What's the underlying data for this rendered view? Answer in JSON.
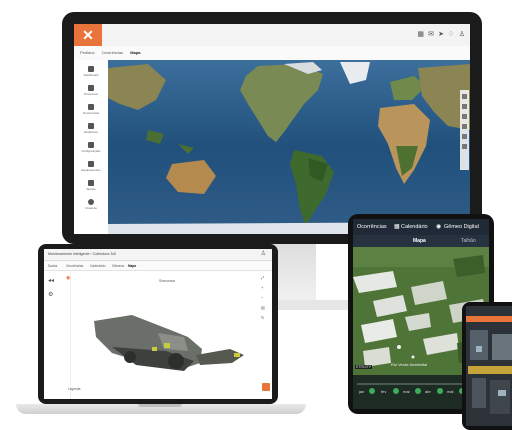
{
  "desktop": {
    "tabs": [
      "Pedidos",
      "Ocorrências",
      "Mapa"
    ],
    "sidebar": [
      "Dashboard",
      "Processos",
      "Ocorrências",
      "Relatórios",
      "Configurações",
      "Equipamentos",
      "Alertas",
      "Usuários"
    ]
  },
  "laptop": {
    "breadcrumb": "Monitoramento Inteligente › Colhedora 3x0",
    "tabs": [
      "Dados",
      "Ocorrências",
      "Calendário",
      "Gêmeos",
      "Mapa"
    ],
    "viewer_label": "Sincronizar",
    "legend_label": "Legenda"
  },
  "tablet": {
    "nav": [
      "Ocorrências",
      "Calendário",
      "Gêmeo Digital"
    ],
    "views": [
      "Mapa",
      "Talhão"
    ],
    "map_label": "Rio Verde Ambiental",
    "map_corner": "ETRO/TP",
    "timeline": [
      "jan",
      "fev",
      "mar",
      "abr",
      "mai",
      "jun"
    ]
  },
  "colors": {
    "accent": "#e8743b",
    "ocean": "#2a5a86",
    "dark": "#1b1b1b"
  }
}
